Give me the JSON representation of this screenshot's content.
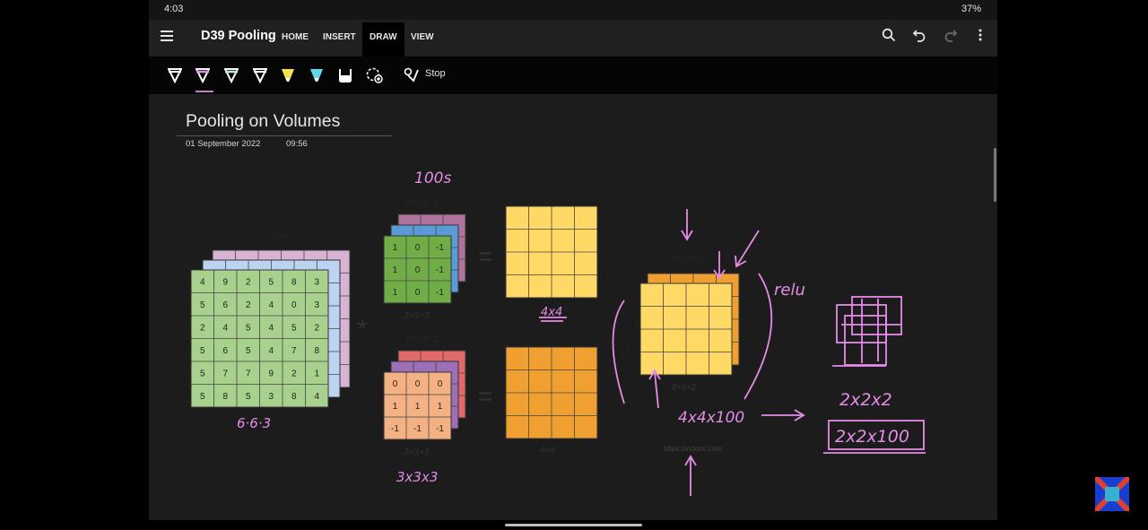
{
  "status_bar": {
    "time": "4:03",
    "battery": "37%"
  },
  "app_bar": {
    "document_title": "D39 Pooling",
    "tabs": [
      {
        "label": "HOME"
      },
      {
        "label": "INSERT"
      },
      {
        "label": "DRAW"
      },
      {
        "label": "VIEW"
      }
    ],
    "active_tab": "DRAW",
    "actions": [
      "search-icon",
      "undo-icon",
      "redo-icon",
      "more-icon"
    ]
  },
  "ribbon": {
    "pens": [
      {
        "name": "pen-white",
        "color": "#ffffff"
      },
      {
        "name": "pen-pink",
        "color": "#e58ce8"
      },
      {
        "name": "pen-white-2",
        "color": "#ffffff"
      },
      {
        "name": "pen-white-3",
        "color": "#ffffff"
      },
      {
        "name": "highlighter-yellow",
        "color": "#f5e24a"
      },
      {
        "name": "highlighter-cyan",
        "color": "#5fd8e8"
      },
      {
        "name": "eraser",
        "color": "#ffffff"
      }
    ],
    "stop_label": "Stop"
  },
  "page": {
    "title": "Pooling on Volumes",
    "date": "01 September 2022",
    "time": "09:56"
  },
  "diagram": {
    "input_label": "Input",
    "input_grid": [
      [
        "4",
        "9",
        "2",
        "5",
        "8",
        "3"
      ],
      [
        "5",
        "6",
        "2",
        "4",
        "0",
        "3"
      ],
      [
        "2",
        "4",
        "5",
        "4",
        "5",
        "2"
      ],
      [
        "5",
        "6",
        "5",
        "4",
        "7",
        "8"
      ],
      [
        "5",
        "7",
        "7",
        "9",
        "2",
        "1"
      ],
      [
        "5",
        "8",
        "5",
        "3",
        "8",
        "4"
      ]
    ],
    "input_dims": "6·6·3",
    "conv_operator": "*",
    "filter1_label": "Filter 1",
    "filter1_grid": [
      [
        "1",
        "0",
        "-1"
      ],
      [
        "1",
        "0",
        "-1"
      ],
      [
        "1",
        "0",
        "-1"
      ]
    ],
    "filter1_dims": "3×3×3",
    "filter2_label": "Filter 2",
    "filter2_grid": [
      [
        "0",
        "0",
        "0"
      ],
      [
        "1",
        "1",
        "1"
      ],
      [
        "-1",
        "-1",
        "-1"
      ]
    ],
    "filter2_dims": "3×3×3",
    "equals": "=",
    "map1_dims": "4×4",
    "map2_dims": "4×4",
    "output_label": "Output",
    "output_dims": "4×4×2",
    "credit": "https://indoml.com",
    "colors": {
      "green": "#a9d18e",
      "green_dark": "#70ad47",
      "blue": "#5b9bd5",
      "purple_front": "#9c6fb8",
      "yellow": "#ffd966",
      "orange": "#f4b183",
      "orange_dark": "#f0a030",
      "pink": "#e58ce8"
    }
  },
  "handwriting": {
    "filters_count": "100s",
    "map1_note": "4x4",
    "relu": "relu",
    "output_size": "4x4x100",
    "filter_size": "3x3x3",
    "pool_size": "2x2x2",
    "pooled_output": "2x2x100"
  }
}
